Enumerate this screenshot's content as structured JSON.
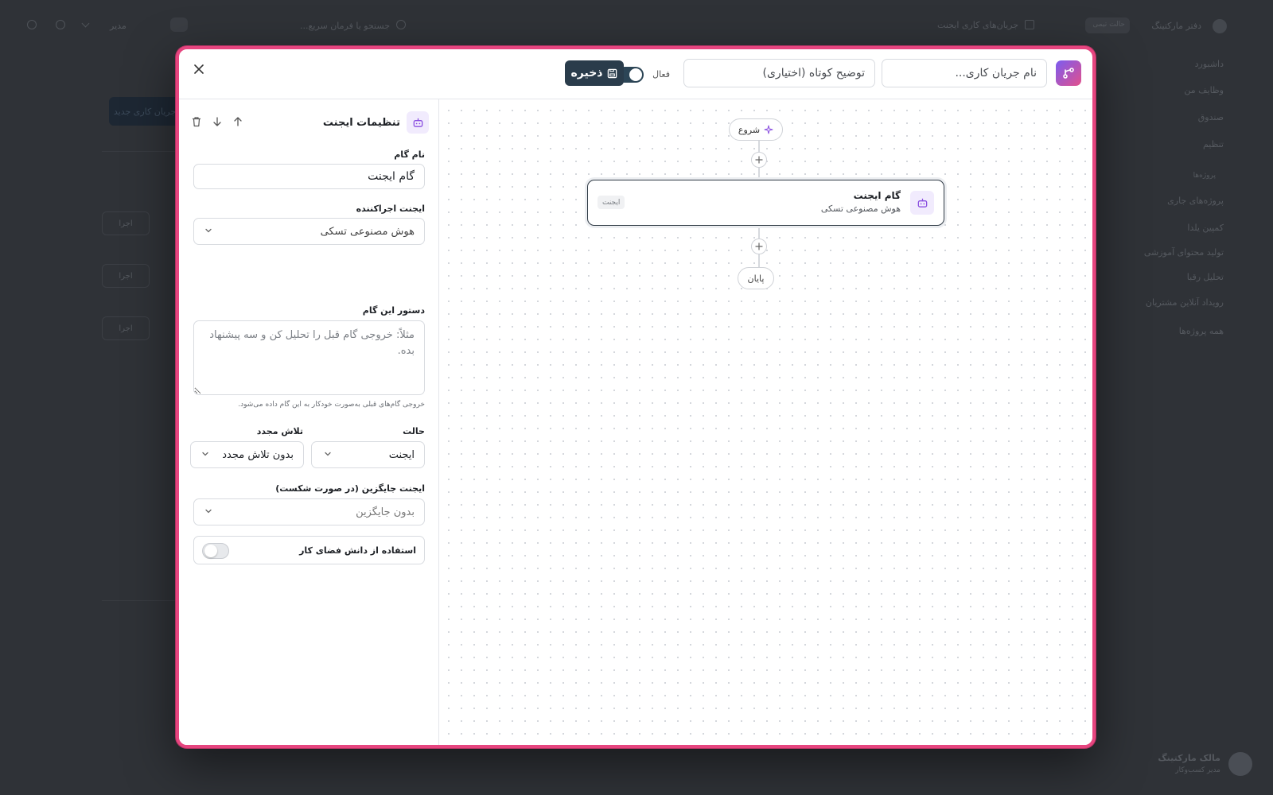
{
  "background": {
    "topbar": {
      "title": "جریان‌های کاری ایجنت",
      "search_placeholder": "جستجو یا فرمان سریع...",
      "workspace": "دفتر مارکتینگ",
      "workspace_badge": "حالت تیمی",
      "user_short": "مدیر"
    },
    "sidebar": {
      "items": [
        "داشبورد",
        "وظایف من",
        "صندوق",
        "تنظیم",
        "پروژه‌های جاری",
        "کمپین یلدا",
        "تولید محتوای آموزشی",
        "تحلیل رقبا",
        "رویداد آنلاین مشتریان",
        "همه پروژه‌ها"
      ],
      "section": "پروژه‌ها"
    },
    "primary_button": "جریان کاری جدید",
    "row_button": "اجرا",
    "user": {
      "name": "مالک مارکتینگ",
      "role": "مدیر کسب‌وکار"
    }
  },
  "modal": {
    "name_placeholder": "نام جریان کاری...",
    "description_placeholder": "توضیح کوتاه (اختیاری)",
    "active_label": "فعال",
    "active": true,
    "save_label": "ذخیره",
    "colors": {
      "border": "#e6457f",
      "save": "#2a3c4b",
      "brand_from": "#7b5cf0",
      "brand_to": "#e2508c",
      "agent_accent": "#8a4fe0"
    }
  },
  "panel": {
    "title": "تنظیمات ایجنت",
    "step_name_label": "نام گام",
    "step_name_value": "گام ایجنت",
    "executor_label": "ایجنت اجراکننده",
    "executor_value": "هوش مصنوعی تسکی",
    "instruction_label": "دستور این گام",
    "instruction_placeholder": "مثلاً: خروجی گام قبل را تحلیل کن و سه پیشنهاد بده.",
    "instruction_helper": "خروجی گام‌های قبلی به‌صورت خودکار به این گام داده می‌شود.",
    "mode_label": "حالت",
    "mode_value": "ایجنت",
    "retry_label": "تلاش مجدد",
    "retry_value": "بدون تلاش مجدد",
    "fallback_label": "ایجنت جایگزین (در صورت شکست)",
    "fallback_value": "بدون جایگزین",
    "knowledge_label": "استفاده از دانش فضای کار",
    "knowledge_enabled": false,
    "icons": [
      "robot-icon",
      "arrow-up-icon",
      "arrow-down-icon",
      "trash-icon"
    ]
  },
  "canvas": {
    "start_label": "شروع",
    "end_label": "پایان",
    "steps": [
      {
        "title": "گام ایجنت",
        "subtitle": "هوش مصنوعی تسکی",
        "badge": "ایجنت"
      }
    ]
  }
}
